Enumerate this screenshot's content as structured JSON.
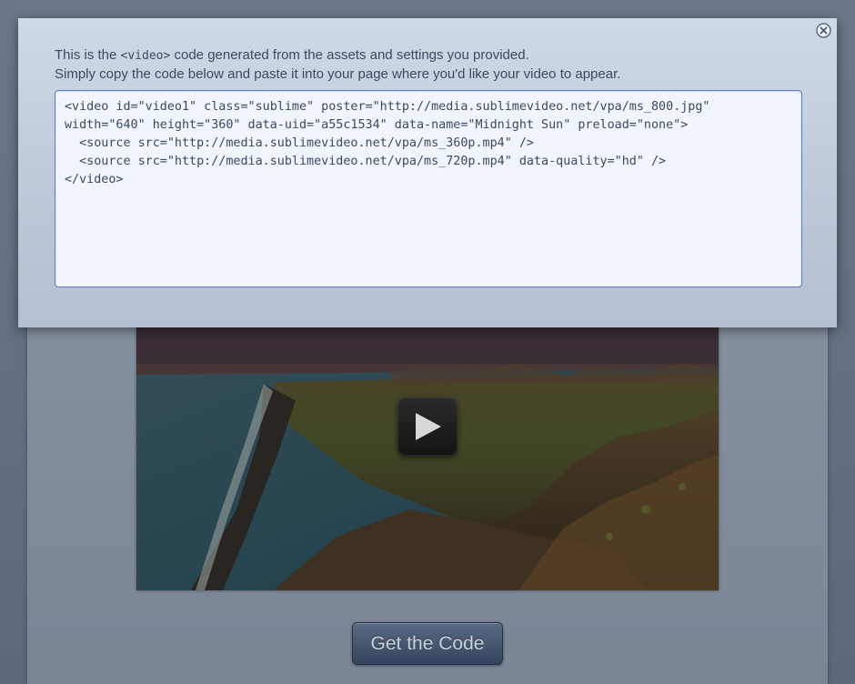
{
  "modal": {
    "intro_line1_prefix": "This is the ",
    "intro_line1_tag": "<video>",
    "intro_line1_suffix": " code generated from the assets and settings you provided.",
    "intro_line2": "Simply copy the code below and paste it into your page where you'd like your video to appear.",
    "code": "<video id=\"video1\" class=\"sublime\" poster=\"http://media.sublimevideo.net/vpa/ms_800.jpg\" width=\"640\" height=\"360\" data-uid=\"a55c1534\" data-name=\"Midnight Sun\" preload=\"none\">\n  <source src=\"http://media.sublimevideo.net/vpa/ms_360p.mp4\" />\n  <source src=\"http://media.sublimevideo.net/vpa/ms_720p.mp4\" data-quality=\"hd\" />\n</video>",
    "close_icon": "close-icon"
  },
  "page": {
    "video": {
      "play_icon": "play-icon"
    },
    "get_code_label": "Get the Code"
  },
  "colors": {
    "modal_bg": "#c6d0e0",
    "code_border": "#5d7fb8",
    "code_bg": "#f0f5fe",
    "button_bg": "#3e4f68"
  }
}
